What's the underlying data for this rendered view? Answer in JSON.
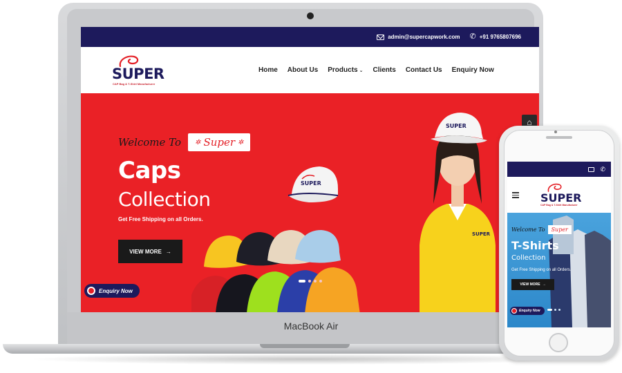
{
  "laptop": {
    "label": "MacBook Air"
  },
  "site": {
    "topbar": {
      "email": "admin@supercapwork.com",
      "phone": "+91 9765807696"
    },
    "logo": {
      "name": "SUPER",
      "tagline": "CAP Bag & T-Shirt Manufacturer"
    },
    "menu": [
      {
        "label": "Home"
      },
      {
        "label": "About Us"
      },
      {
        "label": "Products"
      },
      {
        "label": "Clients"
      },
      {
        "label": "Contact Us"
      },
      {
        "label": "Enquiry Now"
      }
    ],
    "hero": {
      "welcome": "Welcome To",
      "badge": "Super",
      "title": "Caps",
      "subtitle": "Collection",
      "note": "Get Free Shipping on all Orders.",
      "button": "VIEW MORE",
      "enquiry": "Enquiry Now",
      "cap_logo": "SUPER",
      "shirt_logo": "SUPER"
    }
  },
  "phone_site": {
    "logo": {
      "name": "SUPER",
      "tagline": "CAP Bag & T-Shirt Manufacturer"
    },
    "hero": {
      "welcome": "Welcome To",
      "badge": "Super",
      "title": "T-Shirts",
      "subtitle": "Collection",
      "note": "Get Free Shipping on all Orders.",
      "button": "VIEW MORE",
      "enquiry": "Enquiry Now"
    }
  },
  "colors": {
    "navy": "#1d1a5c",
    "red": "#ea2126",
    "phone_hero_blue": "#3a95d4"
  },
  "icons": [
    "mail-icon",
    "phone-icon",
    "home-icon",
    "arrow-right-icon",
    "chevron-down-icon",
    "hamburger-icon"
  ]
}
